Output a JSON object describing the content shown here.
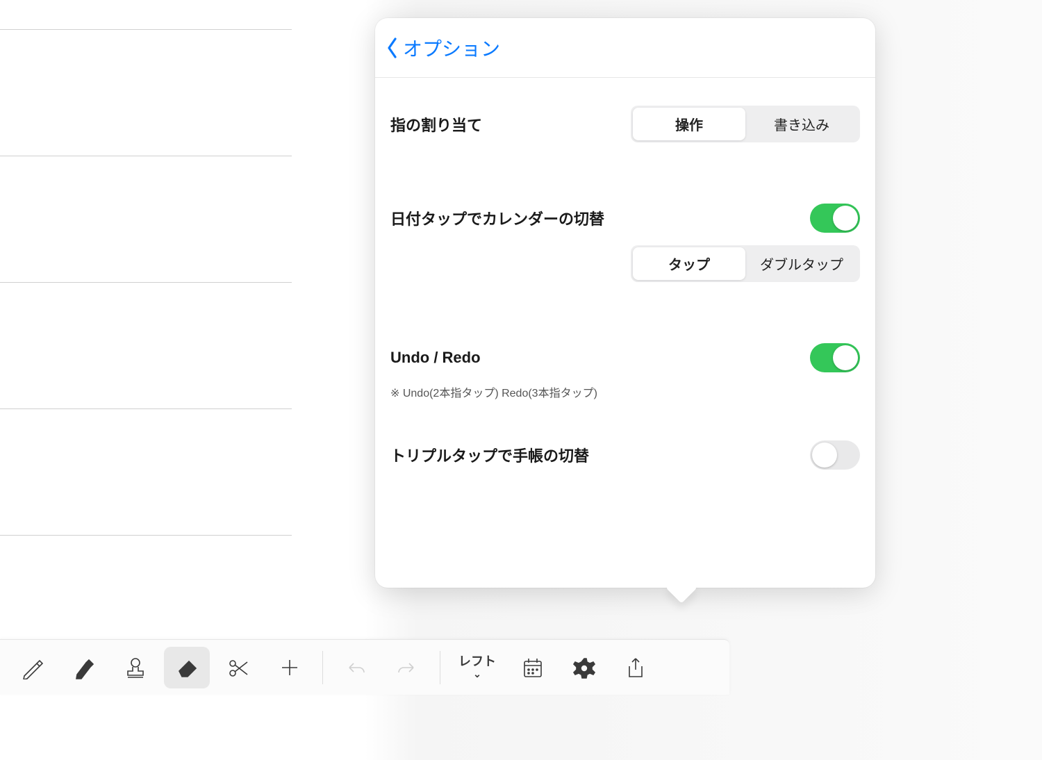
{
  "popover": {
    "back_label": "オプション",
    "finger_assign": {
      "label": "指の割り当て",
      "options": [
        "操作",
        "書き込み"
      ],
      "selected_index": 0
    },
    "date_tap": {
      "label": "日付タップでカレンダーの切替",
      "enabled": true,
      "options": [
        "タップ",
        "ダブルタップ"
      ],
      "selected_index": 0
    },
    "undo_redo": {
      "label": "Undo / Redo",
      "note": "※ Undo(2本指タップ) Redo(3本指タップ)",
      "enabled": true
    },
    "triple_tap": {
      "label": "トリプルタップで手帳の切替",
      "enabled": false
    }
  },
  "toolbar": {
    "left_label": "レフト",
    "icons": {
      "pencil": "pencil-icon",
      "marker": "marker-icon",
      "stamp": "stamp-icon",
      "eraser": "eraser-icon",
      "scissors": "scissors-icon",
      "plus": "plus-icon",
      "undo": "undo-icon",
      "redo": "redo-icon",
      "calendar": "calendar-icon",
      "gear": "gear-icon",
      "share": "share-icon"
    }
  }
}
